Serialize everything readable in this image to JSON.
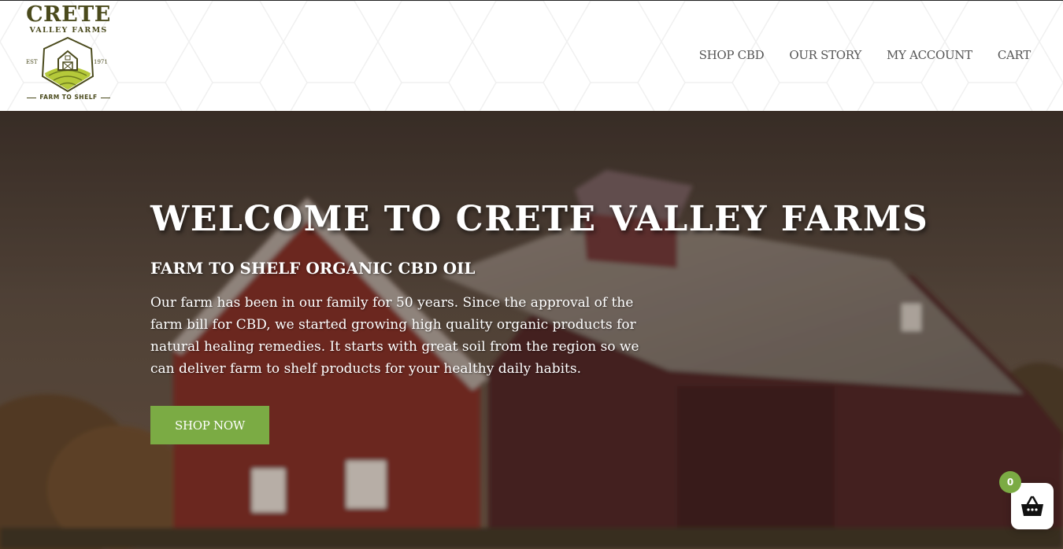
{
  "logo": {
    "title": "CRETE",
    "subtitle": "VALLEY FARMS",
    "est_label": "EST",
    "year": "1971",
    "tagline": "FARM TO SHELF"
  },
  "nav": {
    "items": [
      {
        "label": "SHOP CBD"
      },
      {
        "label": "OUR STORY"
      },
      {
        "label": "MY ACCOUNT"
      },
      {
        "label": "CART"
      }
    ]
  },
  "hero": {
    "title": "WELCOME TO CRETE VALLEY FARMS",
    "subtitle": "FARM TO SHELF ORGANIC CBD OIL",
    "body": "Our farm has been in our family for 50 years. Since the approval of the farm bill for CBD, we started growing high quality organic products for natural healing remedies. It starts with great soil from the region so we can deliver farm to shelf products for your healthy daily habits.",
    "cta_label": "SHOP NOW"
  },
  "cart_widget": {
    "count": "0",
    "icon": "basket-icon"
  },
  "colors": {
    "accent": "#7bab44",
    "logo": "#4a4a1c",
    "nav_text": "#555555"
  }
}
